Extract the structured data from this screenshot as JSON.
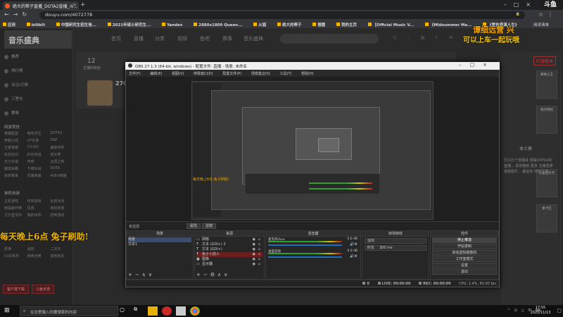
{
  "browser": {
    "tab_title": "绝大的帮子直播_DOTA2直播_斗...",
    "url": "douyu.com/4072778",
    "bookmarks": [
      "应用",
      "bilibili",
      "中国研究生招生信...",
      "2021年硕士研究生...",
      "Yandex",
      "2880x1800 Queen...",
      "火狐",
      "绝大的帮子",
      "搜图",
      "我的主页",
      "【Official Music V...",
      "《Midsummer Ma...",
      "《爱执表演人生》"
    ],
    "bookmarks_right": "阅读清单",
    "brand_mark": "斗鱼"
  },
  "douyu": {
    "logo": "音乐盛典",
    "left_nav": [
      "推荐",
      "排行榜",
      "关注/订阅",
      "三里屯",
      "赛事"
    ],
    "nav_grid_head1": "网游竞技",
    "nav_grid1": [
      "英雄联盟",
      "绝地求生",
      "DOTA2",
      "穿越火线",
      "CF手游",
      "DNF",
      "王者荣耀",
      "CS:GO",
      "魔兽世界",
      "永劫无间",
      "炉石传说",
      "逆水寒",
      "天刀手游",
      "传奇",
      "云顶之弈",
      "魔兽争霸",
      "卡牌对战",
      "DOTA",
      "体育赛事",
      "风暴英雄",
      "APEX英雄"
    ],
    "nav_grid_head2": "单机热游",
    "nav_grid2": [
      "主机游戏",
      "怀旧游戏",
      "永劫无间",
      "暗黑破坏神",
      "饥荒",
      "单机热游",
      "艾尔登法环",
      "我的世界",
      "恐怖游戏",
      "原神",
      "战地",
      "二次元",
      "COD系列",
      "使命召唤",
      "其他单机"
    ],
    "promo": "每天晚上6点 兔子刷助!",
    "left_buttons": [
      "客户端下载",
      "斗鱼手游"
    ],
    "top_nav": [
      "首页",
      "直播",
      "分类",
      "视频",
      "鱼吧",
      "赛事",
      "音乐盛典"
    ],
    "counter": "12",
    "counter_label": "主播的粉丝",
    "num": "270",
    "overlay1": "谭细远营 兴",
    "overlay2": "可以上车一起玩哦",
    "fcb": "FCB粉丝",
    "side_cards": [
      "赛事之王",
      "我的特权",
      "斗鱼狂欢节",
      "集卡区"
    ],
    "side_text": "兄子打个直播哥 观看DOTA2的 直播... 看攻略就 更多 主播选择观看帮忙... 都是你 你的主播",
    "rp_label": "本土推"
  },
  "obs": {
    "title": "OBS 27.1.3 (64-bit, windows) - 配置文件: 直播 - 场景: 未命名",
    "menu": [
      "文件(F)",
      "编辑(E)",
      "视图(V)",
      "停靠窗口(D)",
      "配置文件(P)",
      "场景集合(S)",
      "工具(T)",
      "帮助(H)"
    ],
    "preview_overlay": "每天晚上6点 兔子刷助!",
    "toolbar_label": "未选源",
    "toolbar_buttons": [
      "属性",
      "滤镜"
    ],
    "docks": {
      "scenes": {
        "header": "场景",
        "items": [
          "场景",
          "文本1"
        ]
      },
      "sources": {
        "header": "来源",
        "items": [
          "网络",
          "文本 (GDI+) 2",
          "文本 (GDI+)",
          "兔子小鸽人",
          "图像",
          "显示器"
        ]
      },
      "mixer": {
        "header": "混音器",
        "channels": [
          {
            "name": "麦克风/Aux",
            "db": "0.0 dB"
          },
          {
            "name": "桌面音频",
            "db": "0.0 dB"
          }
        ]
      },
      "transitions": {
        "header": "转场特效",
        "type": "淡出",
        "duration_label": "时长",
        "duration": "300 ms"
      },
      "controls": {
        "header": "控件",
        "buttons": [
          "停止推流",
          "开始录制",
          "启动虚拟摄像机",
          "工作室模式",
          "设置",
          "退出"
        ]
      }
    },
    "status": {
      "drop": "0",
      "live": "LIVE: 00:00:00",
      "rec": "REC: 00:00:00",
      "cpu": "CPU: 1.4%, 60.00 fps"
    }
  },
  "taskbar": {
    "search_placeholder": "在这里输入你要搜索的内容",
    "time": "17:55",
    "date": "2021/11/13",
    "tray": "^ ⊡ ◻ 中 ⌨"
  },
  "colors": {
    "accent_promo": "#f2b500",
    "obs_selection": "#3b4d6e",
    "obs_source_selected": "#6a1e1e",
    "meter_green": "#2da02d"
  }
}
